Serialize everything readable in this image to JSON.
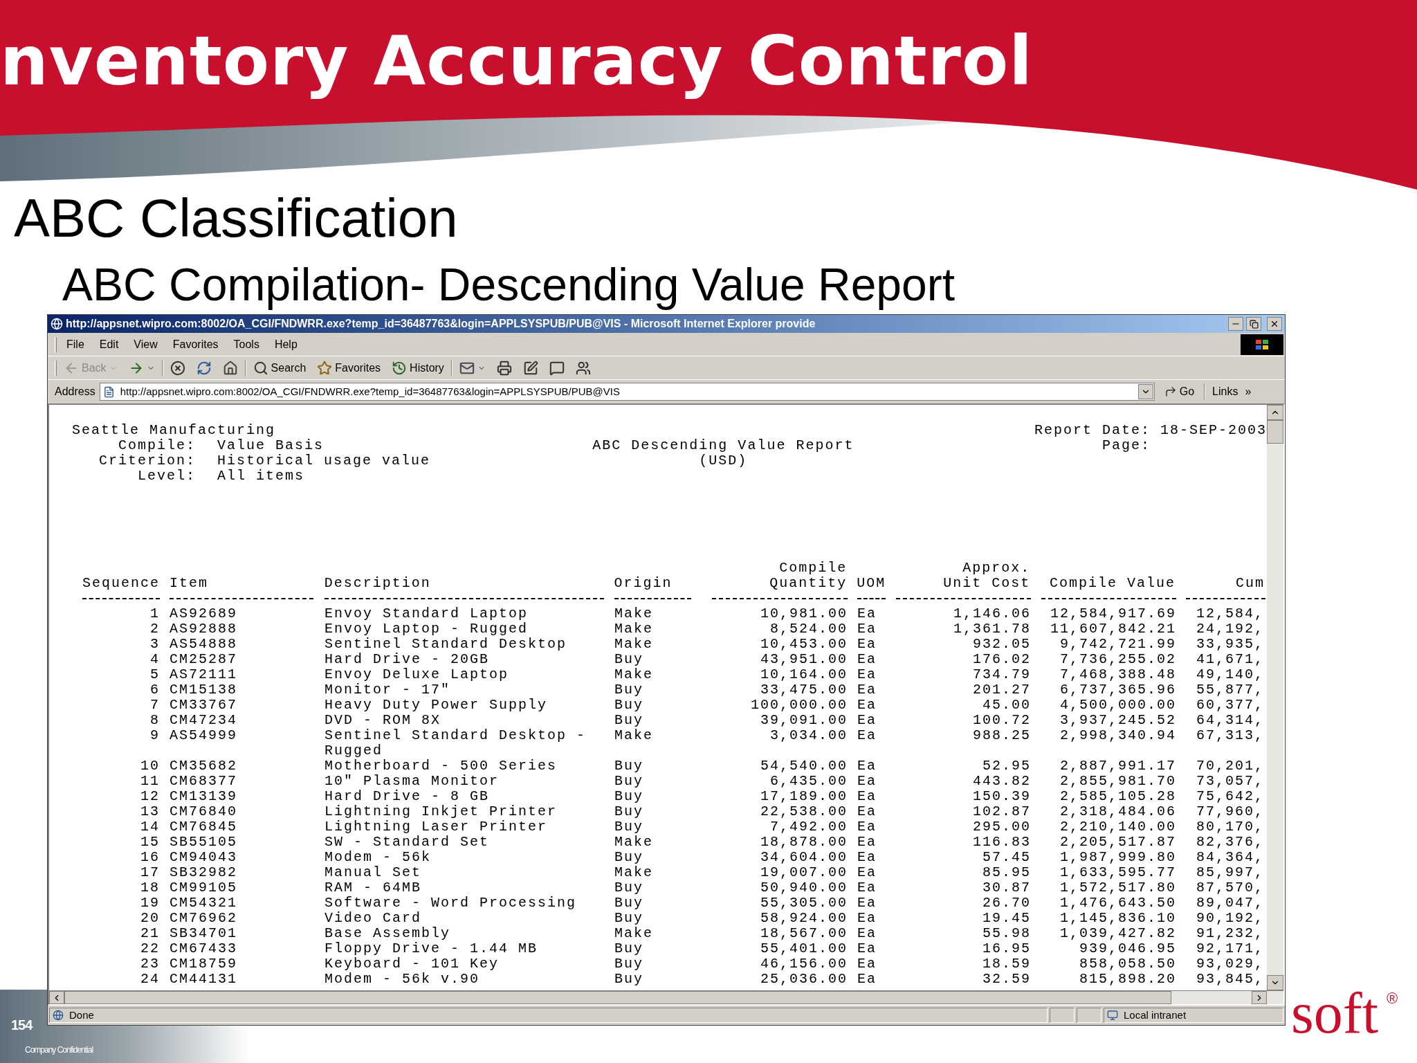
{
  "slide": {
    "title": "nventory Accuracy Control",
    "heading": "ABC Classification",
    "subheading": "ABC Compilation- Descending Value Report",
    "page_number": "154",
    "footer_note": "Company Confidential",
    "logo_text": "soft",
    "logo_mark": "®"
  },
  "browser": {
    "title": "http://appsnet.wipro.com:8002/OA_CGI/FNDWRR.exe?temp_id=36487763&login=APPLSYSPUB/PUB@VIS - Microsoft Internet Explorer provide",
    "menu": [
      "File",
      "Edit",
      "View",
      "Favorites",
      "Tools",
      "Help"
    ],
    "toolbar": [
      [
        {
          "kind": "back",
          "label": "Back",
          "disabled": true,
          "menu": true
        },
        {
          "kind": "forward",
          "disabled": false,
          "menu": true
        }
      ],
      [
        {
          "kind": "stop",
          "disabled": false,
          "menu": false
        },
        {
          "kind": "refresh",
          "disabled": false,
          "menu": false
        },
        {
          "kind": "home",
          "disabled": false,
          "menu": false
        }
      ],
      [
        {
          "kind": "search",
          "label": "Search",
          "disabled": false,
          "menu": false
        },
        {
          "kind": "favorites",
          "label": "Favorites",
          "disabled": false,
          "menu": false
        },
        {
          "kind": "history",
          "label": "History",
          "disabled": false,
          "menu": false
        }
      ],
      [
        {
          "kind": "mail",
          "disabled": false,
          "menu": true
        },
        {
          "kind": "print",
          "disabled": false,
          "menu": false
        },
        {
          "kind": "edit",
          "disabled": false,
          "menu": false
        },
        {
          "kind": "discuss",
          "disabled": false,
          "menu": false
        },
        {
          "kind": "messenger",
          "disabled": false,
          "menu": false
        }
      ]
    ],
    "address": {
      "label": "Address",
      "url": "http://appsnet.wipro.com:8002/OA_CGI/FNDWRR.exe?temp_id=36487763&login=APPLSYSPUB/PUB@VIS",
      "go": "Go",
      "links": "Links",
      "links_more": "»"
    },
    "status": {
      "text": "Done",
      "zone": "Local intranet"
    }
  },
  "report": {
    "company": "Seattle Manufacturing",
    "params": [
      {
        "label": "Compile:",
        "value": "Value Basis"
      },
      {
        "label": "Criterion:",
        "value": "Historical usage value"
      },
      {
        "label": "Level:",
        "value": "All items"
      }
    ],
    "title": "ABC Descending Value Report",
    "currency": "(USD)",
    "date_label": "Report Date:",
    "date": "18-SEP-2003",
    "page_label": "Page:",
    "columns": [
      {
        "label": "Sequence"
      },
      {
        "label": "Item"
      },
      {
        "label": "Description"
      },
      {
        "label": "Origin"
      },
      {
        "above": "Compile",
        "label": "Quantity"
      },
      {
        "label": "UOM"
      },
      {
        "above": "Approx.",
        "label": "Unit Cost"
      },
      {
        "label": "Compile Value"
      },
      {
        "label": "Cum"
      }
    ],
    "rows": [
      [
        "1",
        "AS92689",
        "Envoy Standard Laptop",
        "Make",
        "10,981.00",
        "Ea",
        "1,146.06",
        "12,584,917.69",
        "12,584,"
      ],
      [
        "2",
        "AS92888",
        "Envoy Laptop - Rugged",
        "Make",
        "8,524.00",
        "Ea",
        "1,361.78",
        "11,607,842.21",
        "24,192,"
      ],
      [
        "3",
        "AS54888",
        "Sentinel Standard Desktop",
        "Make",
        "10,453.00",
        "Ea",
        "932.05",
        "9,742,721.99",
        "33,935,"
      ],
      [
        "4",
        "CM25287",
        "Hard Drive - 20GB",
        "Buy",
        "43,951.00",
        "Ea",
        "176.02",
        "7,736,255.02",
        "41,671,"
      ],
      [
        "5",
        "AS72111",
        "Envoy Deluxe Laptop",
        "Make",
        "10,164.00",
        "Ea",
        "734.79",
        "7,468,388.48",
        "49,140,"
      ],
      [
        "6",
        "CM15138",
        "Monitor - 17\"",
        "Buy",
        "33,475.00",
        "Ea",
        "201.27",
        "6,737,365.96",
        "55,877,"
      ],
      [
        "7",
        "CM33767",
        "Heavy Duty Power Supply",
        "Buy",
        "100,000.00",
        "Ea",
        "45.00",
        "4,500,000.00",
        "60,377,"
      ],
      [
        "8",
        "CM47234",
        "DVD - ROM 8X",
        "Buy",
        "39,091.00",
        "Ea",
        "100.72",
        "3,937,245.52",
        "64,314,"
      ],
      [
        "9",
        "AS54999",
        "Sentinel Standard Desktop - Rugged",
        "Make",
        "3,034.00",
        "Ea",
        "988.25",
        "2,998,340.94",
        "67,313,"
      ],
      [
        "10",
        "CM35682",
        "Motherboard - 500 Series",
        "Buy",
        "54,540.00",
        "Ea",
        "52.95",
        "2,887,991.17",
        "70,201,"
      ],
      [
        "11",
        "CM68377",
        "10\" Plasma Monitor",
        "Buy",
        "6,435.00",
        "Ea",
        "443.82",
        "2,855,981.70",
        "73,057,"
      ],
      [
        "12",
        "CM13139",
        "Hard Drive - 8 GB",
        "Buy",
        "17,189.00",
        "Ea",
        "150.39",
        "2,585,105.28",
        "75,642,"
      ],
      [
        "13",
        "CM76840",
        "Lightning Inkjet Printer",
        "Buy",
        "22,538.00",
        "Ea",
        "102.87",
        "2,318,484.06",
        "77,960,"
      ],
      [
        "14",
        "CM76845",
        "Lightning Laser Printer",
        "Buy",
        "7,492.00",
        "Ea",
        "295.00",
        "2,210,140.00",
        "80,170,"
      ],
      [
        "15",
        "SB55105",
        "SW - Standard Set",
        "Make",
        "18,878.00",
        "Ea",
        "116.83",
        "2,205,517.87",
        "82,376,"
      ],
      [
        "16",
        "CM94043",
        "Modem - 56k",
        "Buy",
        "34,604.00",
        "Ea",
        "57.45",
        "1,987,999.80",
        "84,364,"
      ],
      [
        "17",
        "SB32982",
        "Manual Set",
        "Make",
        "19,007.00",
        "Ea",
        "85.95",
        "1,633,595.77",
        "85,997,"
      ],
      [
        "18",
        "CM99105",
        "RAM - 64MB",
        "Buy",
        "50,940.00",
        "Ea",
        "30.87",
        "1,572,517.80",
        "87,570,"
      ],
      [
        "19",
        "CM54321",
        "Software - Word Processing",
        "Buy",
        "55,305.00",
        "Ea",
        "26.70",
        "1,476,643.50",
        "89,047,"
      ],
      [
        "20",
        "CM76962",
        "Video Card",
        "Buy",
        "58,924.00",
        "Ea",
        "19.45",
        "1,145,836.10",
        "90,192,"
      ],
      [
        "21",
        "SB34701",
        "Base Assembly",
        "Make",
        "18,567.00",
        "Ea",
        "55.98",
        "1,039,427.82",
        "91,232,"
      ],
      [
        "22",
        "CM67433",
        "Floppy Drive - 1.44 MB",
        "Buy",
        "55,401.00",
        "Ea",
        "16.95",
        "939,046.95",
        "92,171,"
      ],
      [
        "23",
        "CM18759",
        "Keyboard - 101 Key",
        "Buy",
        "46,156.00",
        "Ea",
        "18.59",
        "858,058.50",
        "93,029,"
      ],
      [
        "24",
        "CM44131",
        "Modem - 56k v.90",
        "Buy",
        "25,036.00",
        "Ea",
        "32.59",
        "815,898.20",
        "93,845,"
      ]
    ]
  }
}
